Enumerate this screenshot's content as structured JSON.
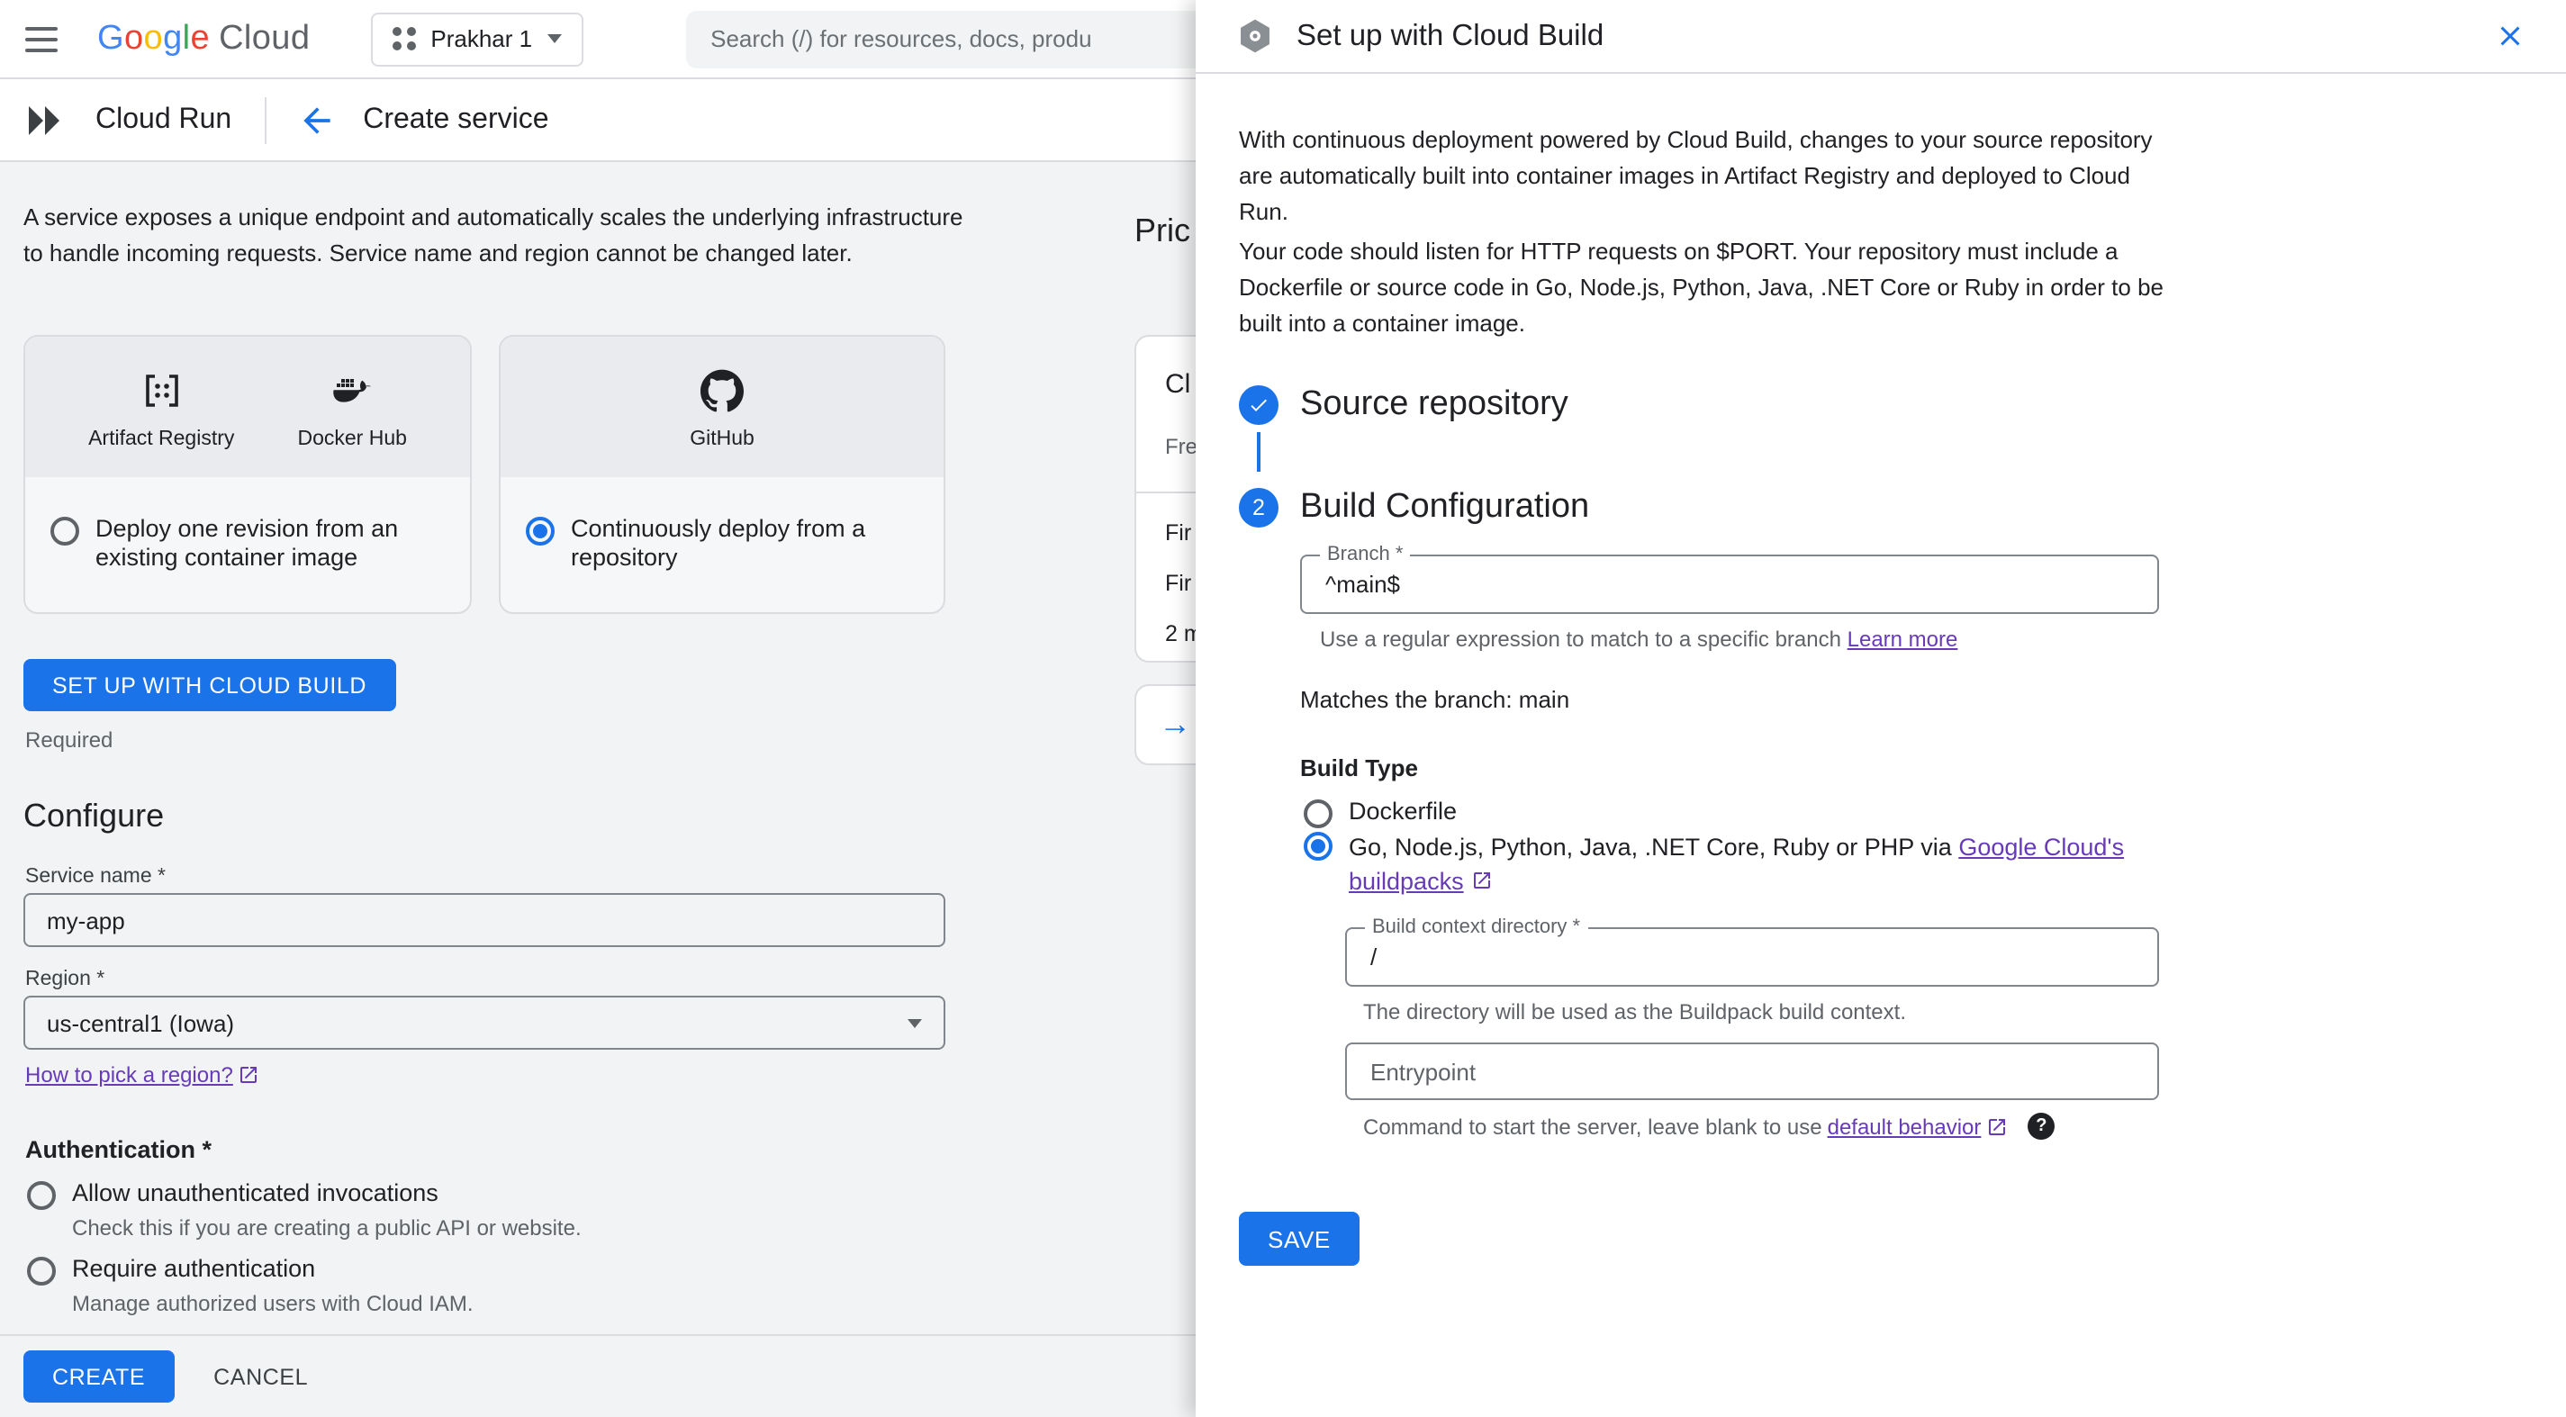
{
  "colors": {
    "accent": "#1a73e8",
    "link": "#673ab7",
    "text": "#202124",
    "text-secondary": "#5f6368",
    "border": "#dadce0",
    "field-border": "#80868b",
    "content-bg": "#f1f3f4",
    "panel-bg": "#ffffff"
  },
  "topbar": {
    "logo": {
      "letters": [
        {
          "ch": "G",
          "color": "#4285F4"
        },
        {
          "ch": "o",
          "color": "#EA4335"
        },
        {
          "ch": "o",
          "color": "#FBBC04"
        },
        {
          "ch": "g",
          "color": "#4285F4"
        },
        {
          "ch": "l",
          "color": "#34A853"
        },
        {
          "ch": "e",
          "color": "#EA4335"
        }
      ],
      "suffix": "Cloud"
    },
    "project": "Prakhar 1",
    "search_placeholder": "Search (/) for resources, docs, produ"
  },
  "subheader": {
    "product": "Cloud Run",
    "page_title": "Create service"
  },
  "main": {
    "intro": "A service exposes a unique endpoint and automatically scales the underlying infrastructure to handle incoming requests. Service name and region cannot be changed later.",
    "source_cards": {
      "registry_card": {
        "icons": [
          {
            "label": "Artifact Registry"
          },
          {
            "label": "Docker Hub"
          }
        ],
        "radio_label": "Deploy one revision from an existing container image",
        "checked": false
      },
      "repo_card": {
        "icons": [
          {
            "label": "GitHub"
          }
        ],
        "radio_label": "Continuously deploy from a repository",
        "checked": true
      }
    },
    "setup_button": "SET UP WITH CLOUD BUILD",
    "required_note": "Required",
    "configure": {
      "heading": "Configure",
      "service_name": {
        "label": "Service name *",
        "value": "my-app"
      },
      "region": {
        "label": "Region *",
        "value": "us-central1 (Iowa)"
      },
      "region_link": "How to pick a region?"
    },
    "authentication": {
      "heading": "Authentication *",
      "options": [
        {
          "label": "Allow unauthenticated invocations",
          "description": "Check this if you are creating a public API or website.",
          "checked": false
        },
        {
          "label": "Require authentication",
          "description": "Manage authorized users with Cloud IAM.",
          "checked": false
        }
      ]
    },
    "actions": {
      "create": "CREATE",
      "cancel": "CANCEL"
    }
  },
  "pricing": {
    "heading": "Pric",
    "card": {
      "title": "Cl",
      "subtitle": "Fre",
      "rows": [
        "Fir",
        "Fir",
        "2 m"
      ]
    },
    "nav_arrow": "→"
  },
  "panel": {
    "title": "Set up with Cloud Build",
    "intro_1": "With continuous deployment powered by Cloud Build, changes to your source repository are automatically built into container images in Artifact Registry and deployed to Cloud Run.",
    "intro_2": "Your code should listen for HTTP requests on $PORT. Your repository must include a Dockerfile or source code in Go, Node.js, Python, Java, .NET Core or Ruby in order to be built into a container image.",
    "steps": [
      {
        "title": "Source repository"
      },
      {
        "number": "2",
        "title": "Build Configuration"
      }
    ],
    "branch": {
      "label": "Branch *",
      "value": "^main$",
      "helper": "Use a regular expression to match to a specific branch ",
      "helper_link": "Learn more"
    },
    "match_note": "Matches the branch: main",
    "build_type": {
      "label": "Build Type",
      "options": [
        {
          "label": "Dockerfile",
          "checked": false
        },
        {
          "label_prefix": "Go, Node.js, Python, Java, .NET Core, Ruby or PHP via ",
          "link": "Google Cloud's buildpacks",
          "checked": true
        }
      ]
    },
    "context_dir": {
      "label": "Build context directory *",
      "value": "/",
      "helper": "The directory will be used as the Buildpack build context."
    },
    "entrypoint": {
      "label": "Entrypoint",
      "helper": "Command to start the server, leave blank to use ",
      "helper_link": "default behavior"
    },
    "save_button": "SAVE"
  }
}
